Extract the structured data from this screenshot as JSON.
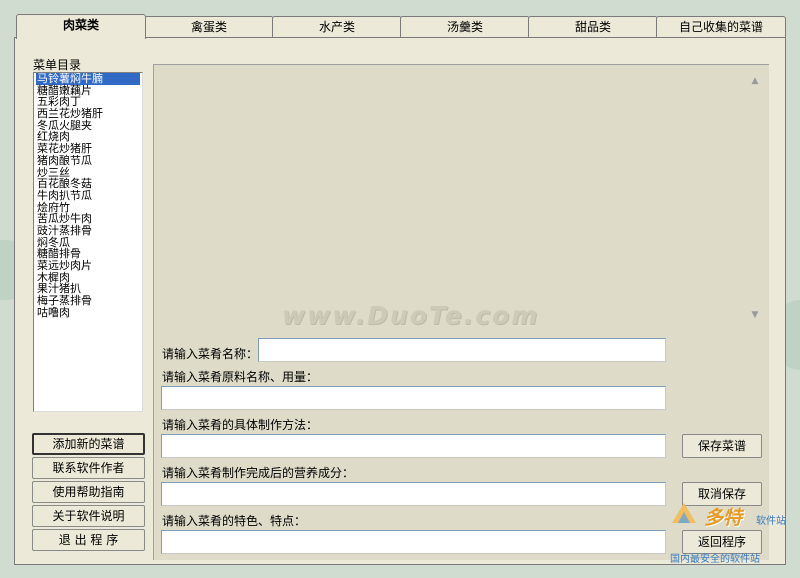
{
  "tabs": [
    "肉菜类",
    "禽蛋类",
    "水产类",
    "汤羹类",
    "甜品类",
    "自己收集的菜谱"
  ],
  "active_tab": "肉菜类",
  "menu_label": "菜单目录",
  "menu_items": [
    "马铃薯焖牛腩",
    "糖醋嫩藕片",
    "五彩肉丁",
    "西兰花炒猪肝",
    "冬瓜火腿夹",
    "红烧肉",
    "菜花炒猪肝",
    "猪肉酿节瓜",
    "炒三丝",
    "百花酿冬菇",
    "牛肉扒节瓜",
    "烩府竹",
    "苦瓜炒牛肉",
    "豉汁蒸排骨",
    "焖冬瓜",
    "糖醋排骨",
    "菜远炒肉片",
    "木樨肉",
    "果汁猪扒",
    "梅子蒸排骨",
    "咕噜肉"
  ],
  "selected_menu_item": "马铃薯焖牛腩",
  "left_buttons": [
    "添加新的菜谱",
    "联系软件作者",
    "使用帮助指南",
    "关于软件说明",
    "退 出 程 序"
  ],
  "watermark": "www.DuoTe.com",
  "form": {
    "name_label": "请输入菜肴名称：",
    "name_value": "",
    "ingredients_label": "请输入菜肴原料名称、用量：",
    "ingredients_value": "",
    "method_label": "请输入菜肴的具体制作方法：",
    "method_value": "",
    "nutrition_label": "请输入菜肴制作完成后的营养成分：",
    "nutrition_value": "",
    "features_label": "请输入菜肴的特色、特点：",
    "features_value": ""
  },
  "right_buttons": {
    "save": "保存菜谱",
    "cancel": "取消保存",
    "back": "返回程序"
  },
  "logo": {
    "main": "多特",
    "sub": "软件站",
    "tagline": "国内最安全的软件站"
  },
  "colors": {
    "selection": "#316ac5",
    "panel": "#ece9d8",
    "background": "#cfdccf"
  }
}
